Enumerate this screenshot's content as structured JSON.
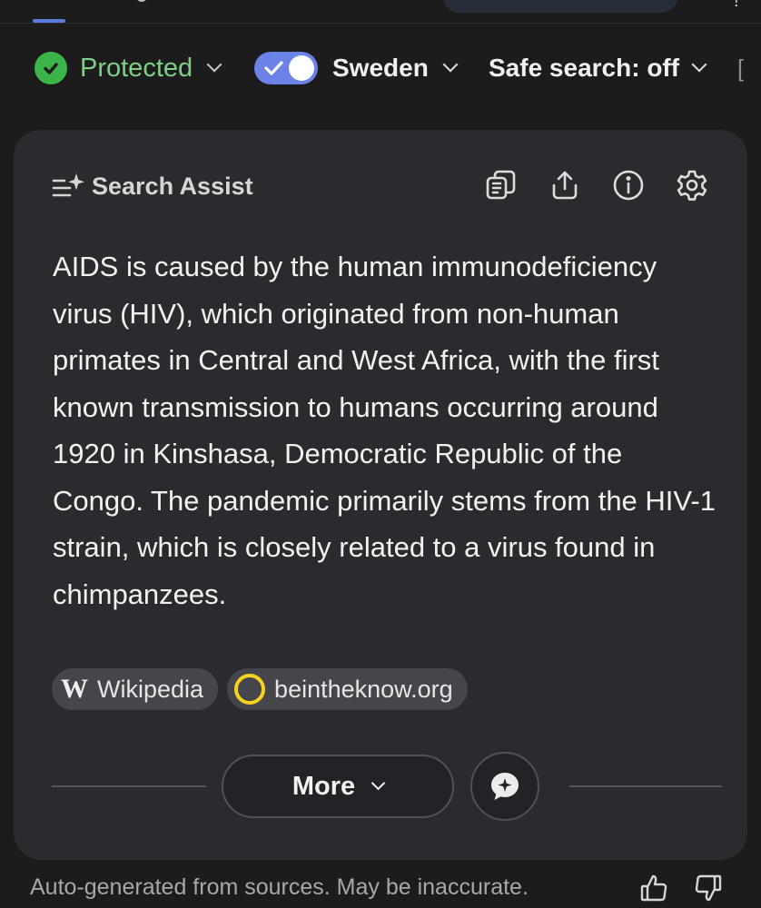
{
  "filters": {
    "protection": {
      "label": "Protected",
      "status_icon": "check-circle-icon",
      "color": "#7ed084"
    },
    "region": {
      "label": "Sweden",
      "toggle_on": true,
      "toggle_color": "#6b83e6"
    },
    "safe_search": {
      "label": "Safe search: off"
    },
    "overflow_glyph": "[",
    "top_overflow_glyph": "!"
  },
  "assist": {
    "title": "Search Assist",
    "icons": [
      "copy-icon",
      "share-icon",
      "info-icon",
      "settings-icon"
    ],
    "answer": "AIDS is caused by the human immunodeficiency virus (HIV), which originated from non-human primates in Central and West Africa, with the first known transmission to humans occurring around 1920 in Kinshasa, Democratic Republic of the Congo. The pandemic primarily stems from the HIV-1 strain, which is closely related to a virus found in chimpanzees.",
    "sources": [
      {
        "icon_glyph": "W",
        "label": "Wikipedia"
      },
      {
        "label": "beintheknow.org",
        "ring_color": "#f4d21e"
      }
    ],
    "more_label": "More"
  },
  "footer": {
    "disclaimer": "Auto-generated from sources. May be inaccurate."
  },
  "colors": {
    "background": "#1c1c1c",
    "card": "#2a2b2f",
    "accent": "#5b7bdc"
  }
}
